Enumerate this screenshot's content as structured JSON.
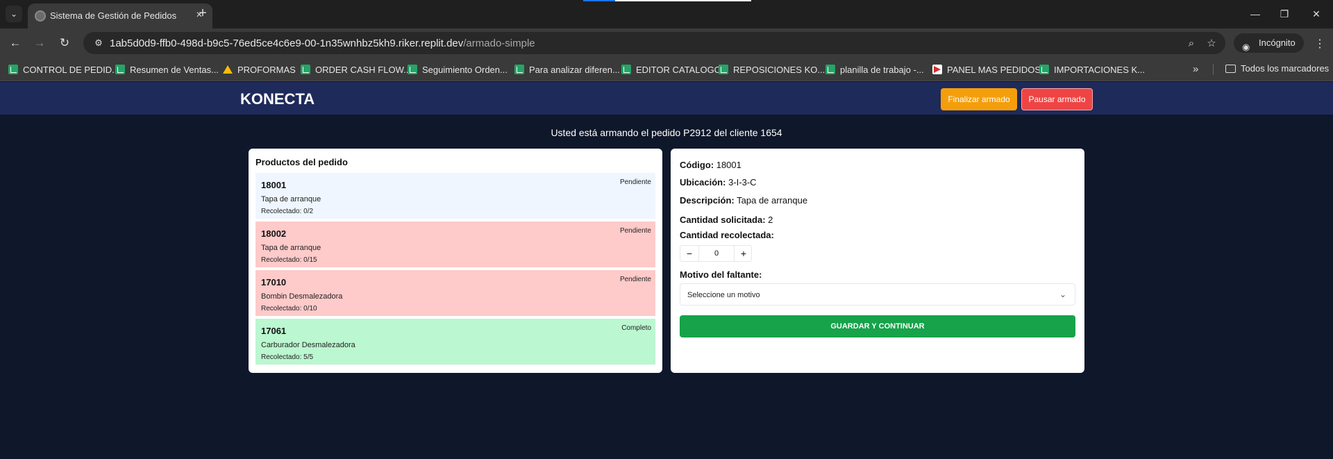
{
  "browser": {
    "tab_title": "Sistema de Gestión de Pedidos",
    "url_host": "1ab5d0d9-ffb0-498d-b9c5-76ed5ce4c6e9-00-1n35wnhbz5kh9.riker.replit.dev",
    "url_path": "/armado-simple",
    "incognito_label": "Incógnito",
    "bookmarks": [
      {
        "label": "CONTROL DE PEDID...",
        "icon": "sheets-icon"
      },
      {
        "label": "Resumen de Ventas...",
        "icon": "sheets-icon"
      },
      {
        "label": "PROFORMAS",
        "icon": "drive-icon"
      },
      {
        "label": "ORDER CASH FLOW...",
        "icon": "sheets-icon"
      },
      {
        "label": "Seguimiento Orden...",
        "icon": "sheets-icon"
      },
      {
        "label": "Para analizar diferen...",
        "icon": "sheets-icon"
      },
      {
        "label": "EDITOR CATALOGO",
        "icon": "sheets-icon"
      },
      {
        "label": "REPOSICIONES KO...",
        "icon": "sheets-icon"
      },
      {
        "label": "planilla de trabajo -...",
        "icon": "sheets-icon"
      },
      {
        "label": "PANEL MAS PEDIDOS",
        "icon": "panel-icon"
      },
      {
        "label": "IMPORTACIONES K...",
        "icon": "sheets-icon"
      }
    ],
    "all_bookmarks_label": "Todos los marcadores"
  },
  "header": {
    "brand": "KONECTA",
    "finish_label": "Finalizar armado",
    "pause_label": "Pausar armado"
  },
  "notice": "Usted está armando el pedido P2912 del cliente 1654",
  "products": {
    "title": "Productos del pedido",
    "items": [
      {
        "code": "18001",
        "description": "Tapa de arranque",
        "collected": "Recolectado: 0/2",
        "status": "Pendiente",
        "color": "#eff6ff"
      },
      {
        "code": "18002",
        "description": "Tapa de arranque",
        "collected": "Recolectado: 0/15",
        "status": "Pendiente",
        "color": "#fecaca"
      },
      {
        "code": "17010",
        "description": "Bombin Desmalezadora",
        "collected": "Recolectado: 0/10",
        "status": "Pendiente",
        "color": "#fecaca"
      },
      {
        "code": "17061",
        "description": "Carburador Desmalezadora",
        "collected": "Recolectado: 5/5",
        "status": "Completo",
        "color": "#bbf7d0"
      }
    ]
  },
  "detail": {
    "code_label": "Código:",
    "code_value": "18001",
    "location_label": "Ubicación:",
    "location_value": "3-I-3-C",
    "description_label": "Descripción:",
    "description_value": "Tapa de arranque",
    "requested_label": "Cantidad solicitada:",
    "requested_value": "2",
    "collected_label": "Cantidad recolectada:",
    "collected_value": "0",
    "reason_label": "Motivo del faltante:",
    "reason_placeholder": "Seleccione un motivo",
    "save_label": "GUARDAR Y CONTINUAR"
  }
}
